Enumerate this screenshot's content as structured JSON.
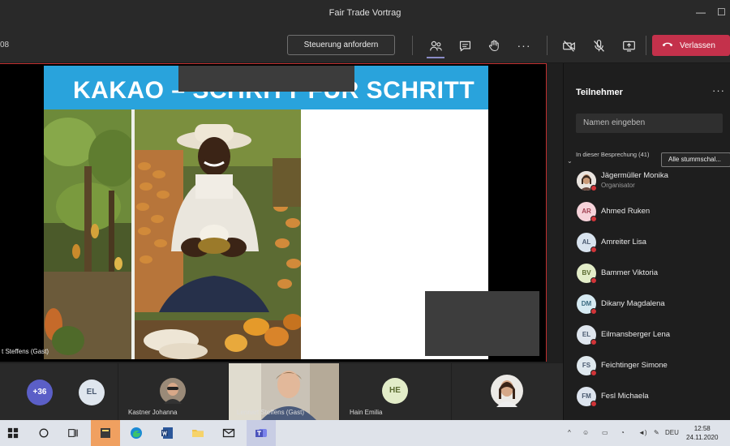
{
  "window": {
    "title": "Fair Trade Vortrag"
  },
  "toolbar": {
    "timer": "08",
    "request_control_label": "Steuerung anfordern",
    "leave_label": "Verlassen",
    "more_label": "···"
  },
  "slide": {
    "title": "KAKAO – SCHRITT FÜR SCHRITT"
  },
  "stage": {
    "speaker_name": "t Steffens (Gast)"
  },
  "participants_panel": {
    "title": "Teilnehmer",
    "more_label": "···",
    "search_placeholder": "Namen eingeben",
    "section_label": "In dieser Besprechung (41)",
    "mute_all_label": "Alle stummschal...",
    "items": [
      {
        "initials": "",
        "name": "Jägermüller Monika",
        "role": "Organisator",
        "color": "#f3d6d0"
      },
      {
        "initials": "AR",
        "name": "Ahmed Ruken",
        "color": "#f6d3da"
      },
      {
        "initials": "AL",
        "name": "Amreiter Lisa",
        "color": "#d8e3ee"
      },
      {
        "initials": "BV",
        "name": "Bammer Viktoria",
        "color": "#e2ecc8"
      },
      {
        "initials": "DM",
        "name": "Dikany Magdalena",
        "color": "#d6eaf2"
      },
      {
        "initials": "EL",
        "name": "Eilmansberger Lena",
        "color": "#dfe6ee"
      },
      {
        "initials": "FS",
        "name": "Feichtinger Simone",
        "color": "#dfe8ee"
      },
      {
        "initials": "FM",
        "name": "Fesl Michaela",
        "color": "#dde4ee"
      }
    ]
  },
  "strip": {
    "overflow_count": "+36",
    "el_initials": "EL",
    "kastner_name": "Kastner Johanna",
    "steffens_name": "Lennart Steffens (Gast)",
    "hain_initials": "HE",
    "hain_name": "Hain Emilia"
  },
  "taskbar": {
    "language": "DEU",
    "time": "12:58",
    "date": "24.11.2020"
  },
  "colors": {
    "leave_red": "#c4314b",
    "slide_blue": "#29a3dc",
    "presence_red": "#d13438",
    "accent_purple": "#8b8cc7"
  }
}
